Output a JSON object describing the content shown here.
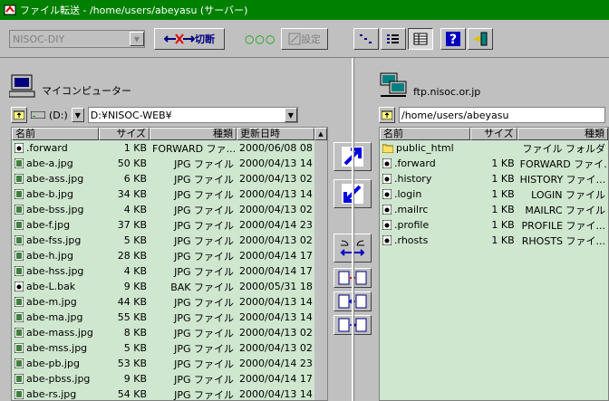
{
  "window": {
    "title": "ファイル転送 - /home/users/abeyasu (サーバー)"
  },
  "toolbar": {
    "profile_value": "NISOC-DIY",
    "disconnect_label": "切断",
    "status_dots": "○○○",
    "settings_label": "設定"
  },
  "local": {
    "label": "マイコンピューター",
    "drive": "(D:)",
    "path": "D:¥NISOC-WEB¥",
    "columns": [
      "名前",
      "サイズ",
      "種類",
      "更新日時"
    ],
    "files": [
      {
        "name": ".forward",
        "size": "1 KB",
        "type": "FORWARD ファ...",
        "date": "2000/06/08 08"
      },
      {
        "name": "abe-a.jpg",
        "size": "50 KB",
        "type": "JPG ファイル",
        "date": "2000/04/13 14"
      },
      {
        "name": "abe-ass.jpg",
        "size": "6 KB",
        "type": "JPG ファイル",
        "date": "2000/04/13 02"
      },
      {
        "name": "abe-b.jpg",
        "size": "34 KB",
        "type": "JPG ファイル",
        "date": "2000/04/13 14"
      },
      {
        "name": "abe-bss.jpg",
        "size": "4 KB",
        "type": "JPG ファイル",
        "date": "2000/04/13 02"
      },
      {
        "name": "abe-f.jpg",
        "size": "37 KB",
        "type": "JPG ファイル",
        "date": "2000/04/14 23"
      },
      {
        "name": "abe-fss.jpg",
        "size": "5 KB",
        "type": "JPG ファイル",
        "date": "2000/04/13 02"
      },
      {
        "name": "abe-h.jpg",
        "size": "28 KB",
        "type": "JPG ファイル",
        "date": "2000/04/14 17"
      },
      {
        "name": "abe-hss.jpg",
        "size": "4 KB",
        "type": "JPG ファイル",
        "date": "2000/04/14 17"
      },
      {
        "name": "abe-L.bak",
        "size": "9 KB",
        "type": "BAK ファイル",
        "date": "2000/05/31 18"
      },
      {
        "name": "abe-m.jpg",
        "size": "44 KB",
        "type": "JPG ファイル",
        "date": "2000/04/13 14"
      },
      {
        "name": "abe-ma.jpg",
        "size": "55 KB",
        "type": "JPG ファイル",
        "date": "2000/04/13 14"
      },
      {
        "name": "abe-mass.jpg",
        "size": "8 KB",
        "type": "JPG ファイル",
        "date": "2000/04/13 02"
      },
      {
        "name": "abe-mss.jpg",
        "size": "5 KB",
        "type": "JPG ファイル",
        "date": "2000/04/13 02"
      },
      {
        "name": "abe-pb.jpg",
        "size": "53 KB",
        "type": "JPG ファイル",
        "date": "2000/04/14 23"
      },
      {
        "name": "abe-pbss.jpg",
        "size": "9 KB",
        "type": "JPG ファイル",
        "date": "2000/04/14 17"
      },
      {
        "name": "abe-rs.jpg",
        "size": "54 KB",
        "type": "JPG ファイル",
        "date": "2000/04/13 14"
      }
    ]
  },
  "remote": {
    "label": "ftp.nisoc.or.jp",
    "path": "/home/users/abeyasu",
    "columns": [
      "名前",
      "サイズ",
      "種類"
    ],
    "files": [
      {
        "name": "public_html",
        "size": "",
        "type": "ファイル フォルダ",
        "folder": true
      },
      {
        "name": ".forward",
        "size": "1 KB",
        "type": "FORWARD ファイ..."
      },
      {
        "name": ".history",
        "size": "1 KB",
        "type": "HISTORY ファイ..."
      },
      {
        "name": ".login",
        "size": "1 KB",
        "type": "LOGIN ファイル"
      },
      {
        "name": ".mailrc",
        "size": "1 KB",
        "type": "MAILRC ファイル"
      },
      {
        "name": ".profile",
        "size": "1 KB",
        "type": "PROFILE ファイ..."
      },
      {
        "name": ".rhosts",
        "size": "1 KB",
        "type": "RHOSTS ファイ..."
      }
    ]
  }
}
